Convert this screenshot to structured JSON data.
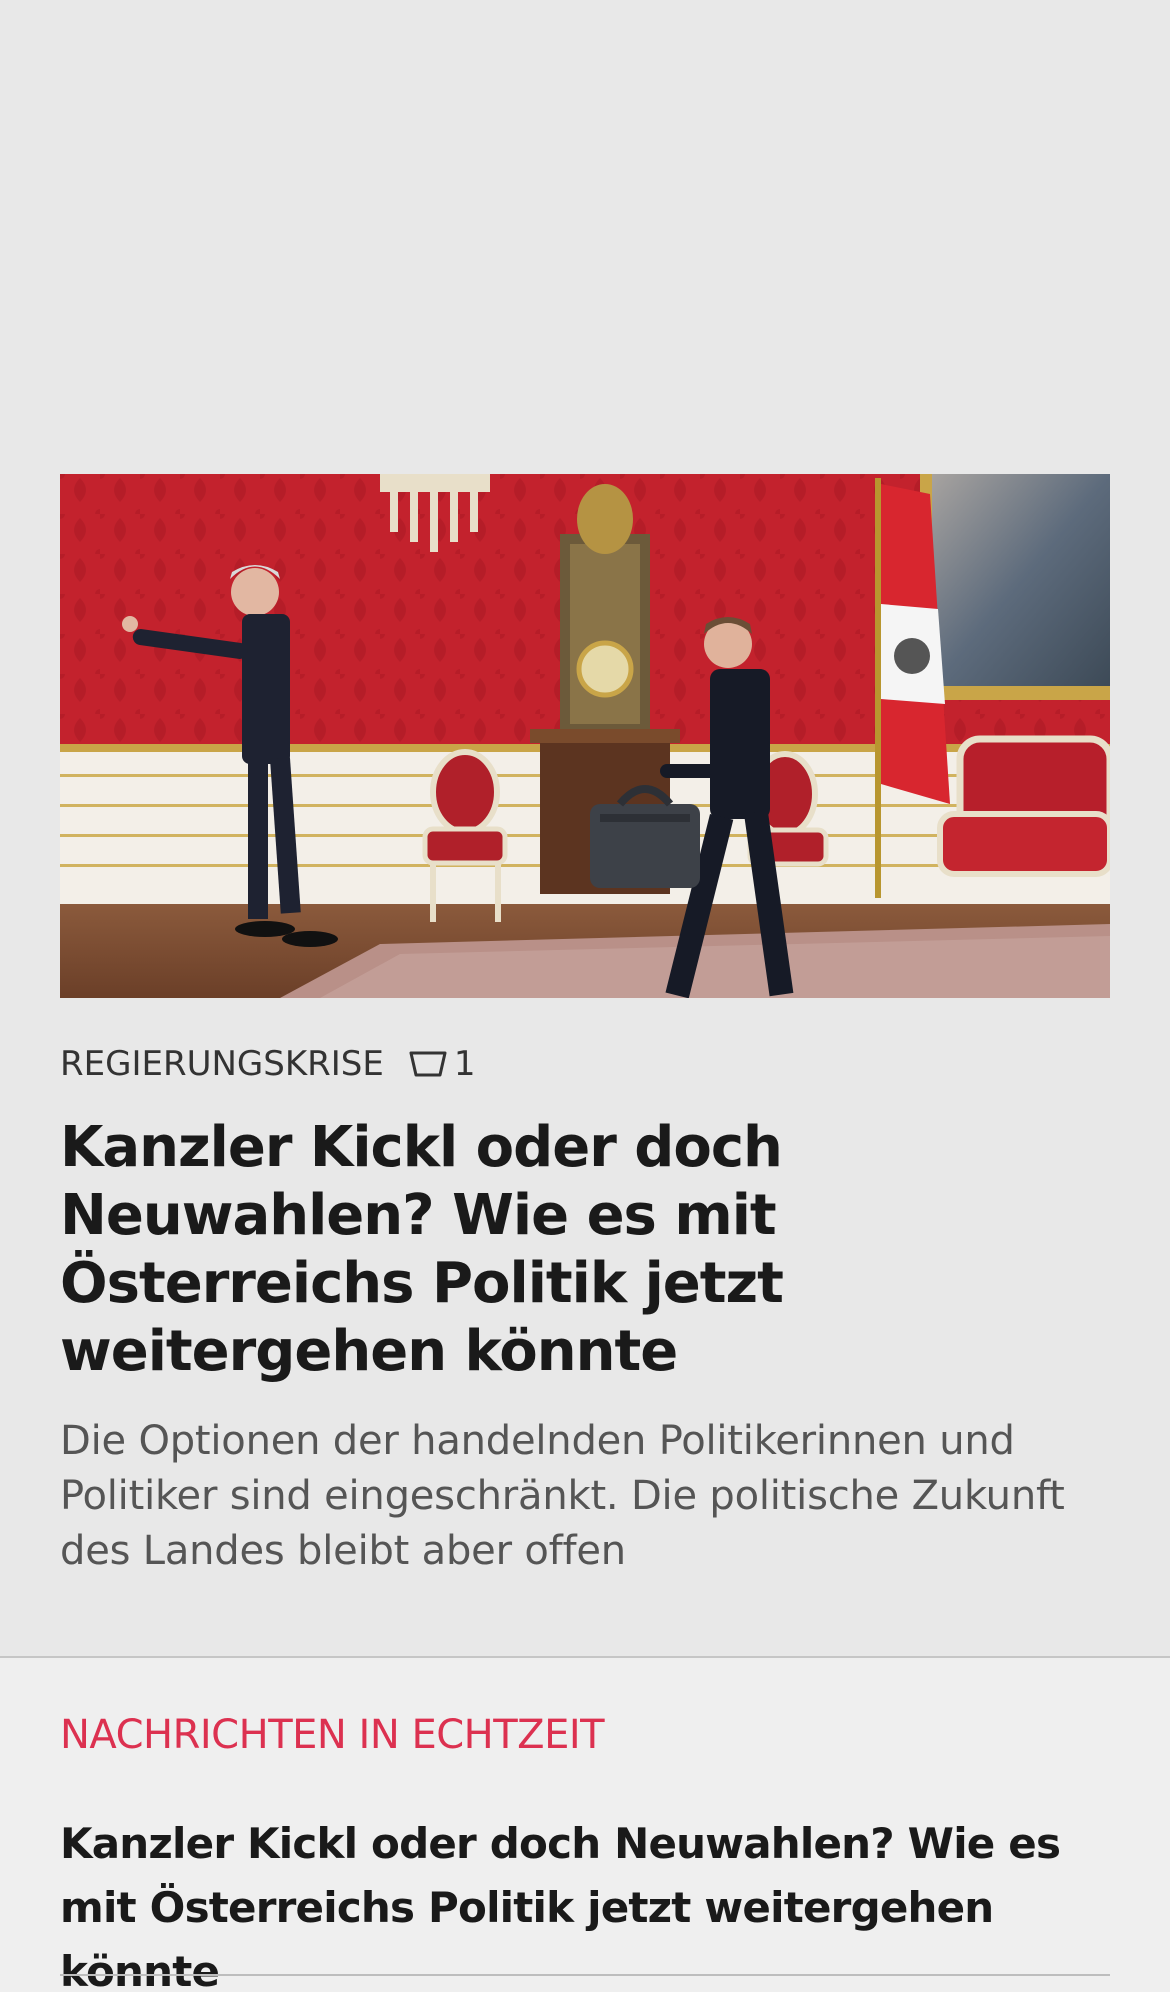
{
  "article": {
    "image_alt": "Photo",
    "kicker": "REGIERUNGSKRISE",
    "comment_count": "1",
    "headline": "Kanzler Kickl oder doch Neuwahlen? Wie es mit Österreichs Politik jetzt weitergehen könnte",
    "teaser": "Die Optionen der handelnden Politikerinnen und Politiker sind eingeschränkt. Die politische Zukunft des Landes bleibt aber offen"
  },
  "live": {
    "section_title": "NACHRICHTEN IN ECHTZEIT",
    "items": [
      {
        "headline": "Kanzler Kickl oder doch Neuwahlen? Wie es mit Österreichs Politik jetzt weitergehen könnte"
      }
    ]
  },
  "colors": {
    "background": "#e8e8e8",
    "accent_live": "#dc3150",
    "headline": "#1a1a1a",
    "teaser": "#555555"
  },
  "icons": {
    "comments": "comment-bubble-icon"
  }
}
